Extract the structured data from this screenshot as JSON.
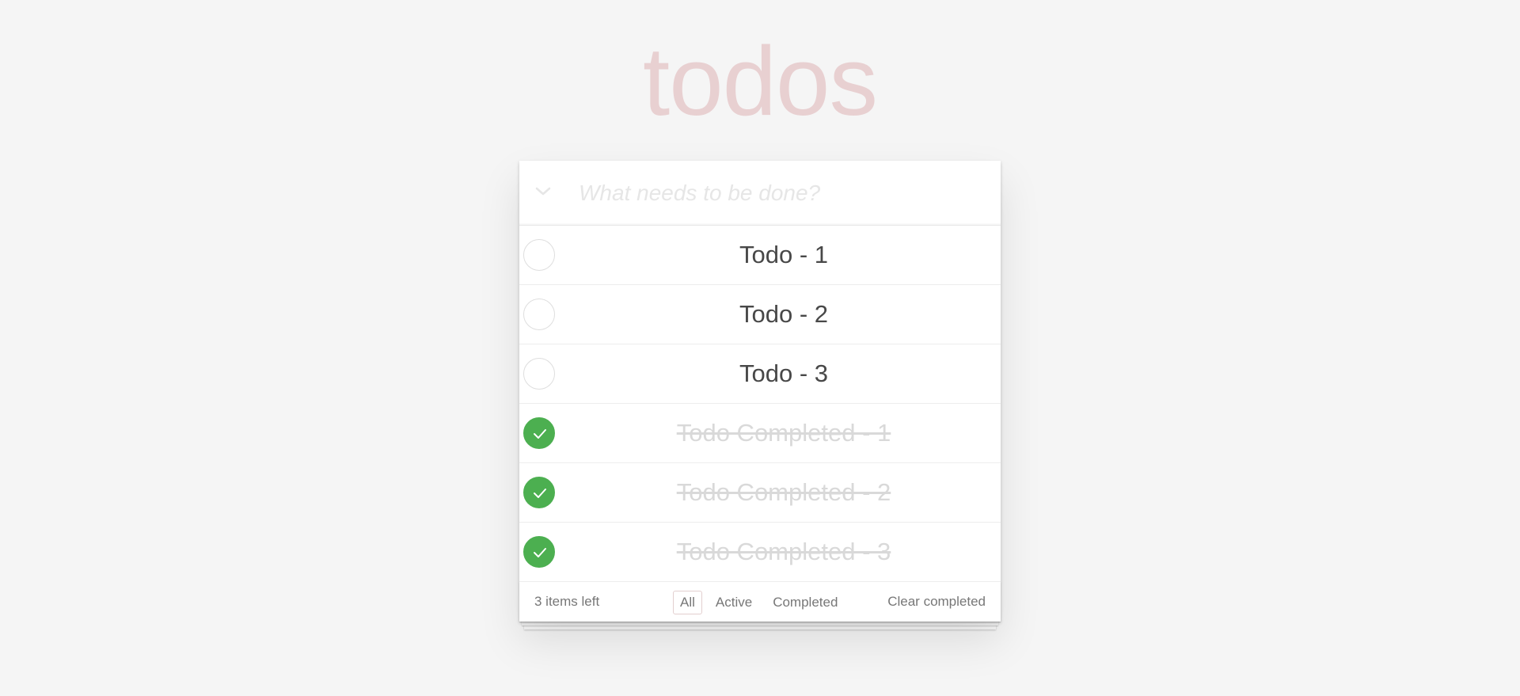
{
  "app": {
    "title": "todos"
  },
  "header": {
    "toggle_all_icon": "chevron-down-icon",
    "new_todo_placeholder": "What needs to be done?",
    "new_todo_value": ""
  },
  "todos": [
    {
      "label": "Todo - 1",
      "completed": false
    },
    {
      "label": "Todo - 2",
      "completed": false
    },
    {
      "label": "Todo - 3",
      "completed": false
    },
    {
      "label": "Todo Completed - 1",
      "completed": true
    },
    {
      "label": "Todo Completed - 2",
      "completed": true
    },
    {
      "label": "Todo Completed - 3",
      "completed": true
    }
  ],
  "footer": {
    "count_text": "3 items left",
    "filters": [
      {
        "label": "All",
        "selected": true
      },
      {
        "label": "Active",
        "selected": false
      },
      {
        "label": "Completed",
        "selected": false
      }
    ],
    "clear_completed_label": "Clear completed"
  },
  "colors": {
    "background": "#f5f5f5",
    "title": "#b83f45",
    "check_completed": "#4caf50",
    "completed_text": "#d9d9d9",
    "filter_selected_border": "#e3cfcf"
  }
}
